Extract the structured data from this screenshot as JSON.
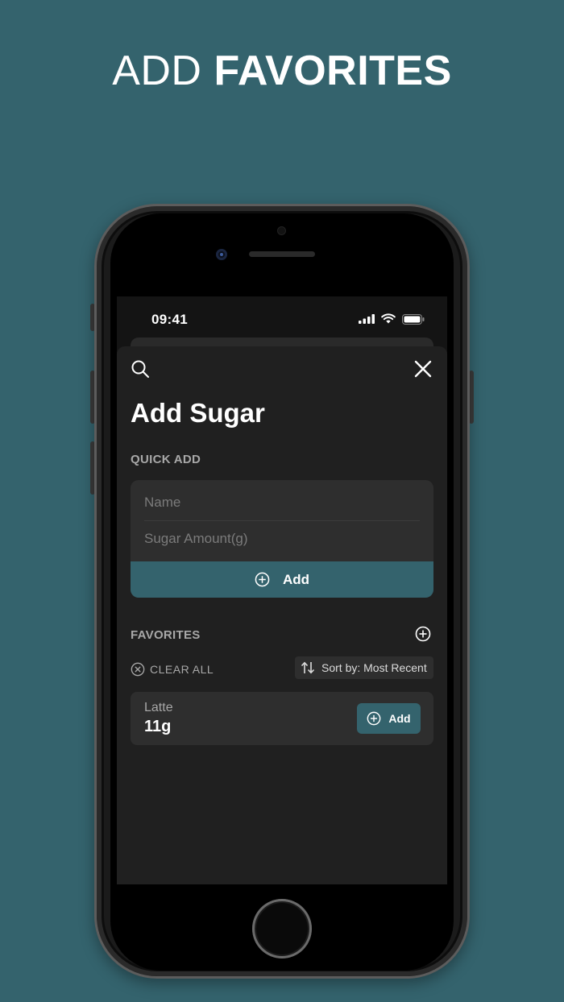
{
  "headline": {
    "light": "ADD",
    "bold": "FAVORITES"
  },
  "status_bar": {
    "time": "09:41"
  },
  "sheet": {
    "title": "Add Sugar",
    "search_icon": "search-icon",
    "close_icon": "close-icon"
  },
  "quick_add": {
    "label": "QUICK ADD",
    "name_placeholder": "Name",
    "sugar_placeholder": "Sugar Amount(g)",
    "add_label": "Add"
  },
  "favorites": {
    "label": "FAVORITES",
    "clear_all": "CLEAR ALL",
    "sort_label": "Sort by: Most Recent",
    "items": [
      {
        "name": "Latte",
        "amount": "11g",
        "add_label": "Add"
      }
    ]
  },
  "colors": {
    "background": "#34636d",
    "accent": "#34636d",
    "sheet": "#202020",
    "card": "#2e2e2e"
  }
}
